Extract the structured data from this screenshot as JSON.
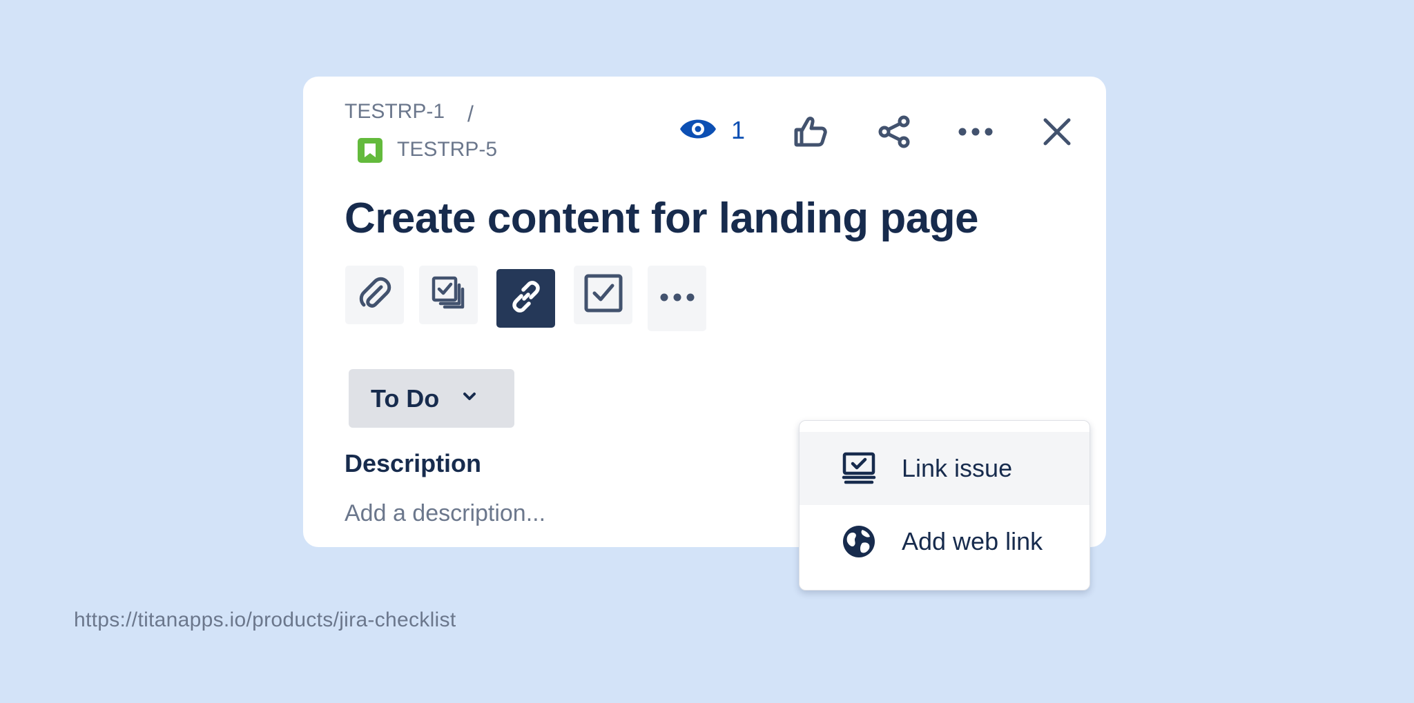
{
  "breadcrumb": {
    "parent": "TESTRP-1",
    "separator": "/",
    "current": "TESTRP-5"
  },
  "header": {
    "watch_count": "1"
  },
  "issue": {
    "title": "Create content for landing page"
  },
  "status": {
    "label": "To Do"
  },
  "description": {
    "label": "Description",
    "placeholder": "Add a description..."
  },
  "link_menu": {
    "items": [
      {
        "label": "Link issue",
        "icon": "link-issue-icon"
      },
      {
        "label": "Add web link",
        "icon": "globe-icon"
      }
    ]
  },
  "footer": {
    "url": "https://titanapps.io/products/jira-checklist"
  },
  "colors": {
    "background": "#d3e3f8",
    "accent_dark": "#253858",
    "watch_blue": "#0c4fb3",
    "story_green": "#63ba3c",
    "text": "#172b4d",
    "muted": "#6b778c"
  }
}
